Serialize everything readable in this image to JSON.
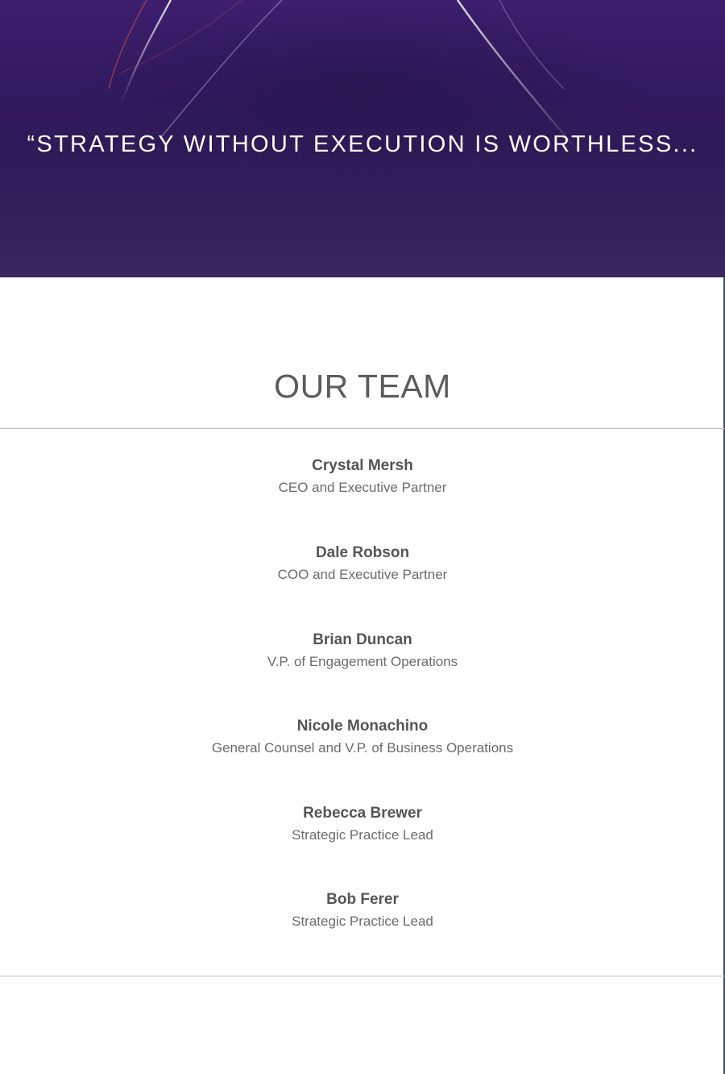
{
  "hero": {
    "quote": "“STRATEGY WITHOUT EXECUTION IS WORTHLESS..."
  },
  "team": {
    "title": "OUR TEAM",
    "members": [
      {
        "name": "Crystal Mersh",
        "role": "CEO and Executive Partner"
      },
      {
        "name": "Dale Robson",
        "role": "COO and Executive Partner"
      },
      {
        "name": "Brian Duncan",
        "role": "V.P. of Engagement Operations"
      },
      {
        "name": "Nicole Monachino",
        "role": "General Counsel and V.P. of Business Operations"
      },
      {
        "name": "Rebecca Brewer",
        "role": "Strategic Practice Lead"
      },
      {
        "name": "Bob Ferer",
        "role": "Strategic Practice Lead"
      }
    ]
  },
  "colors": {
    "hero_background": "#341a61",
    "heading_text": "#5c5c5c",
    "body_text": "#6b6b6b",
    "divider": "#bdbdbd"
  }
}
